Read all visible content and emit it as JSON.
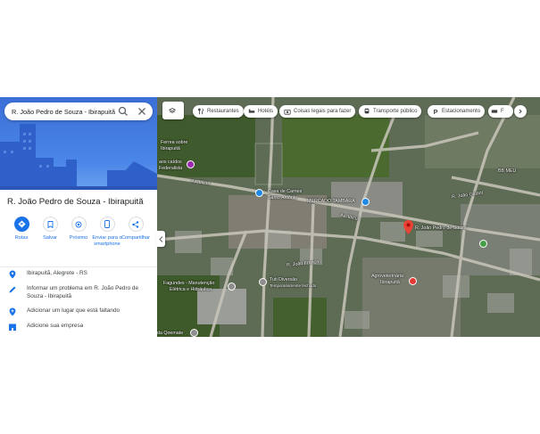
{
  "search": {
    "query": "R. João Pedro de Souza - Ibirapuitã"
  },
  "place": {
    "title": "R. João Pedro de Souza - Ibirapuitã"
  },
  "actions": [
    {
      "label": "Rotas",
      "icon": "directions-icon"
    },
    {
      "label": "Salvar",
      "icon": "bookmark-icon"
    },
    {
      "label": "Próximo",
      "icon": "nearby-icon"
    },
    {
      "label": "Enviar para o smartphone",
      "icon": "send-to-phone-icon"
    },
    {
      "label": "Compartilhar",
      "icon": "share-icon"
    }
  ],
  "info": {
    "location": "Ibirapuitã, Alegrete - RS",
    "report": "Informar um problema em R. João Pedro de Souza - Ibirapuitã",
    "add_place": "Adicionar um lugar que está faltando",
    "add_business": "Adicione sua empresa"
  },
  "chips": [
    "Restaurantes",
    "Hotéis",
    "Coisas legais para fazer",
    "Transporte público",
    "Estacionamento",
    "F"
  ],
  "map_labels": {
    "ferrea": "Ferrea sobre",
    "ferrea2": "Ibirapuitã",
    "caidos": "aos caídos",
    "caidos2": "Federalista",
    "av_ibicui": "Av. Ibicuí",
    "casa_carnes": "Casa de Carnes",
    "casa_carnes2": "Santo Antônio",
    "mercado": "MERCADO TAMBARA",
    "av_ibicui2": "Av. Ibicuí",
    "joao_galant": "R. João Galant",
    "pin": "R. João Pedro de Souza",
    "bb_meu": "BB MEU",
    "joao_franca": "R. João França",
    "tuti": "Tuti Diversão",
    "tuti2": "Temporariamente fechado",
    "fagundes": "Fagundes - Manutenção",
    "fagundes2": "Elétrica e Hidráulica",
    "agro": "Agroveterinária",
    "agro2": "Ibirapuitã",
    "qoemeste": "da Qoemate"
  },
  "colors": {
    "accent": "#1a73e8",
    "action_fill": "#1a73e8",
    "pin": "#ea4335",
    "panel_bg": "#ffffff"
  }
}
